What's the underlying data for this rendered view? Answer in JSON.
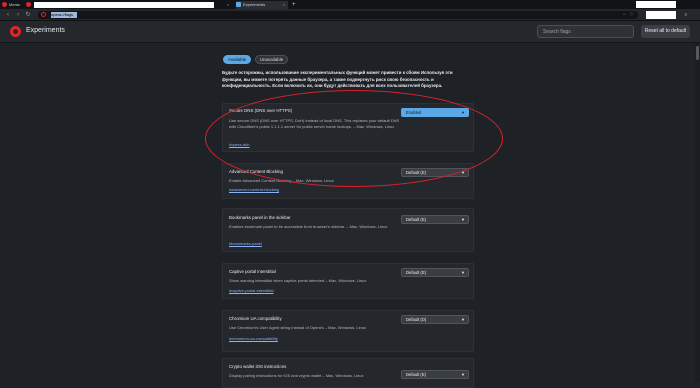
{
  "browser": {
    "tabs": [
      {
        "label": "Меню"
      },
      {
        "label": ""
      },
      {
        "label": "Experiments"
      }
    ],
    "new_tab_symbol": "+",
    "tab_close_symbol": "×",
    "url": "opera://flags",
    "nav": {
      "back": "‹",
      "forward": "›",
      "reload": "↻"
    }
  },
  "header": {
    "title": "Experiments",
    "search_placeholder": "Search flags",
    "reset_label": "Reset all to default"
  },
  "view_tabs": {
    "available": "Available",
    "unavailable": "Unavailable"
  },
  "warning": "Будьте осторожны, использование экспериментальных функций может привести к сбоям Используя эти функции, вы можете потерять данные браузера, а также подвергнуть риск свою безопасность и конфиденциальность. Если включить их, они будут действовать для всех пользователей браузера.",
  "flags": [
    {
      "title": "Secure DNS (DNS over HTTPS)",
      "description": "Use secure DNS (DNS over HTTPS, DoH) instead of local DNS. This replaces your default DNS with Cloudflare's public 1.1.1.1 server for public server name lookups. – Mac, Windows, Linux",
      "link": "#opera-doh",
      "value": "Enabled"
    },
    {
      "title": "Advanced Content Blocking",
      "description": "Enable Advanced Content Blocking – Mac, Windows, Linux",
      "link": "#advanced-content-blocking",
      "value": "Default (E)"
    },
    {
      "title": "Bookmarks panel in the sidebar",
      "description": "Enables bookmark panel to be accessible from browser's sidebar. – Mac, Windows, Linux",
      "link": "#bookmarks-panel",
      "value": "Default (E)"
    },
    {
      "title": "Captive portal interstitial",
      "description": "Show warning interstitial when captive portal detected – Mac, Windows, Linux",
      "link": "#captive-portal-interstitial",
      "value": "Default (E)"
    },
    {
      "title": "Chromium UA compatibility",
      "description": "Use Chromium's User Agent string instead of Opera's – Mac, Windows, Linux",
      "link": "#chromium-ua-compatibility",
      "value": "Default (D)"
    },
    {
      "title": "Crypto wallet iOS instructions",
      "description": "Display pairing instructions for iOS and crypto wallet – Mac, Windows, Linux",
      "link": "",
      "value": "Default (E)"
    }
  ],
  "colors": {
    "accent": "#5aa9e6",
    "annotation": "#d8232a",
    "opera_red": "#e0242f"
  }
}
